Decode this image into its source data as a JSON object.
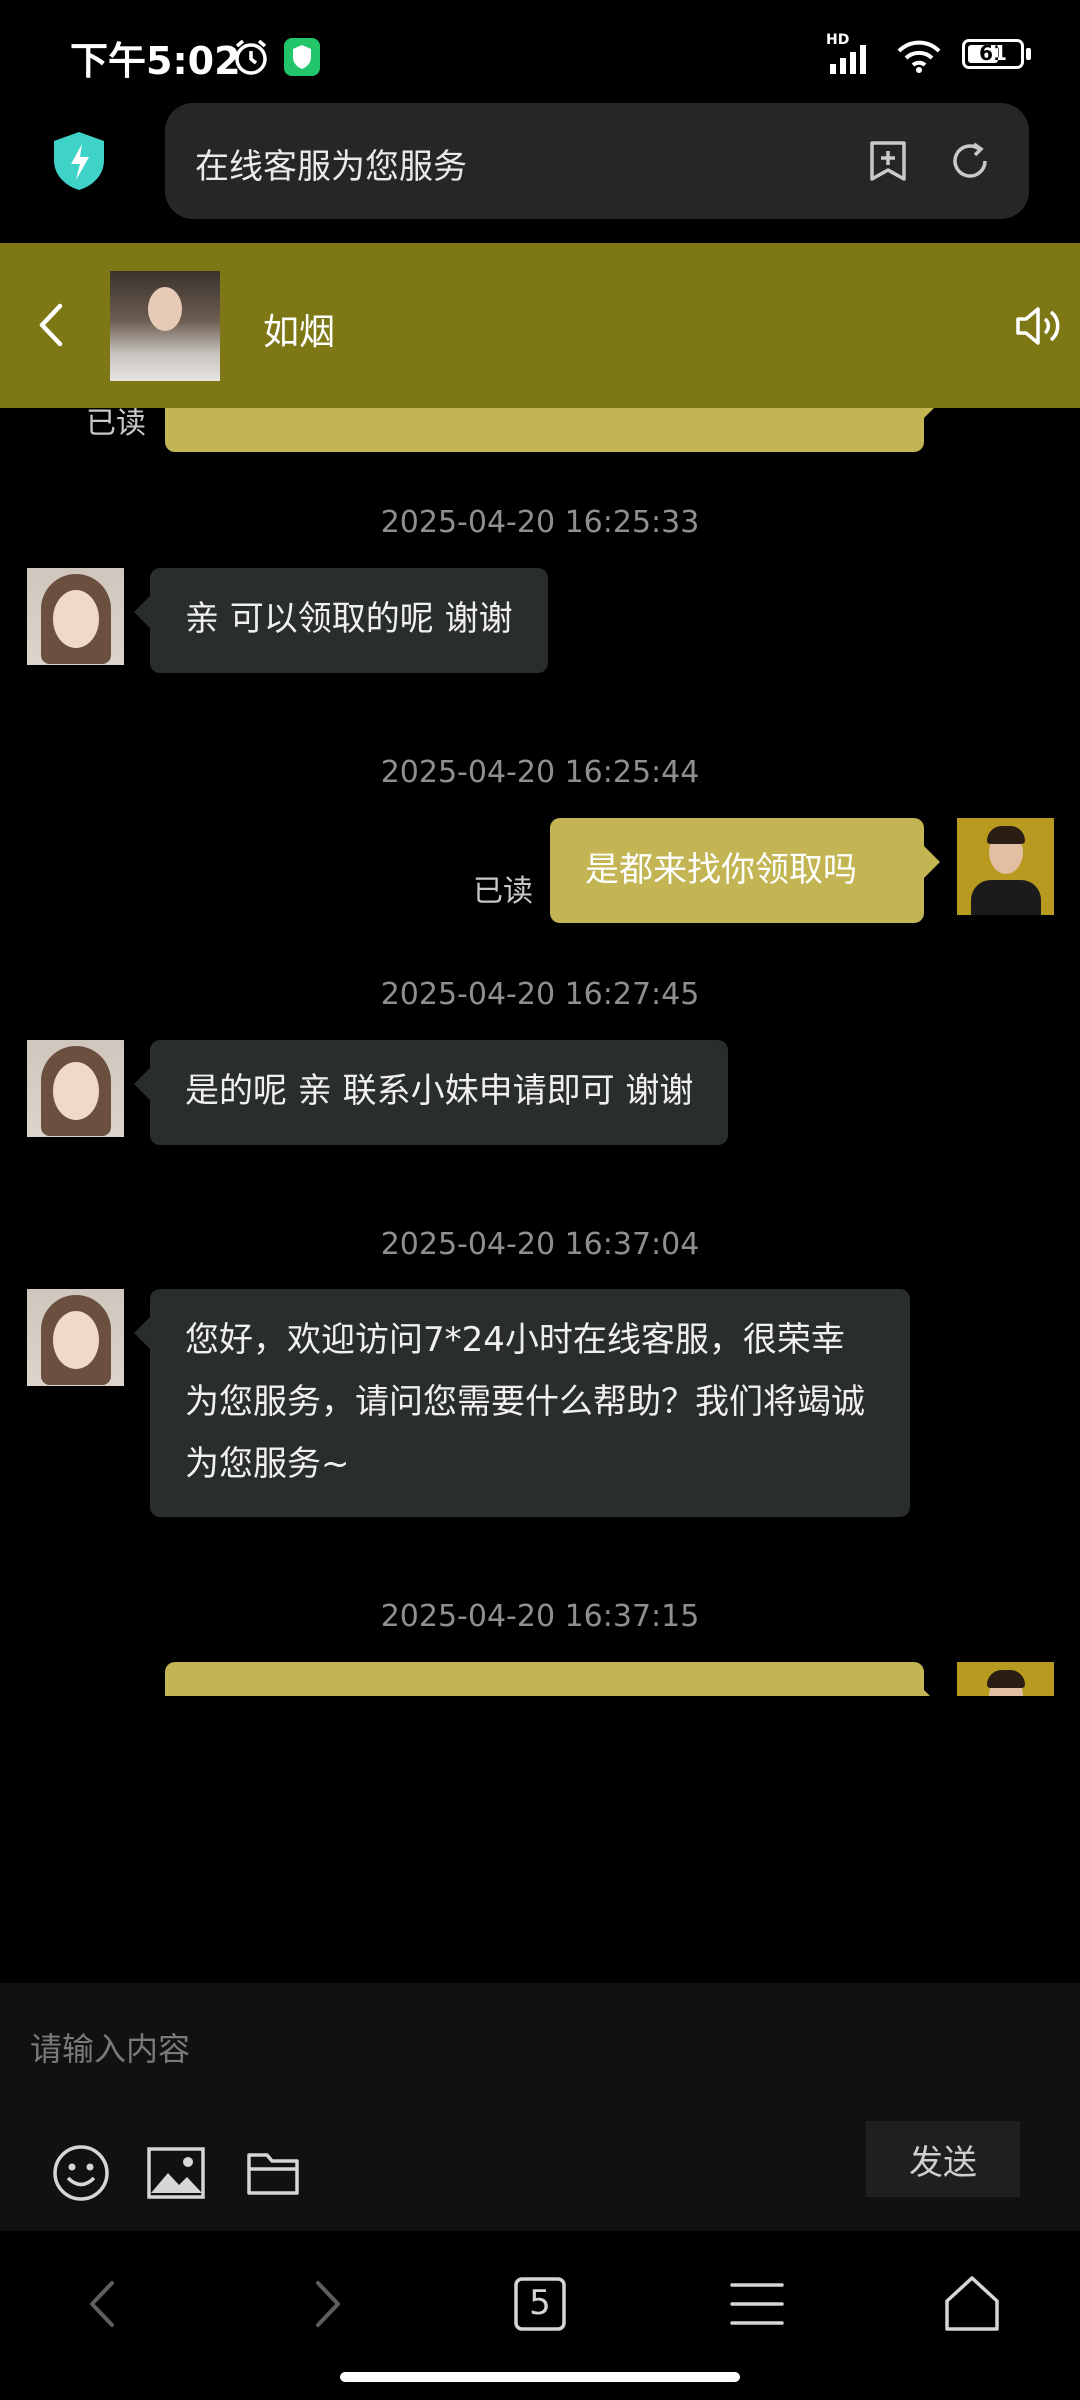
{
  "status_bar": {
    "time": "下午5:02",
    "network_label": "HD",
    "battery": "61"
  },
  "browser": {
    "address_text": "在线客服为您服务"
  },
  "chat_header": {
    "contact_name": "如烟"
  },
  "messages": [
    {
      "timestamp": "2025-04-20 16:25:33",
      "sender": "agent",
      "text": "亲 可以领取的呢 谢谢"
    },
    {
      "timestamp": "2025-04-20 16:25:44",
      "sender": "user",
      "text": "是都来找你领取吗",
      "status": "已读"
    },
    {
      "timestamp": "2025-04-20 16:27:45",
      "sender": "agent",
      "text": "是的呢 亲 联系小妹申请即可 谢谢"
    },
    {
      "timestamp": "2025-04-20 16:37:04",
      "sender": "agent",
      "text": "您好，欢迎访问7*24小时在线客服，很荣幸为您服务，请问您需要什么帮助？我们将竭诚为您服务~"
    },
    {
      "timestamp": "2025-04-20 16:37:15",
      "sender": "user",
      "text": ""
    }
  ],
  "partial_top": {
    "status": "已读"
  },
  "input": {
    "placeholder": "请输入内容",
    "send_label": "发送"
  },
  "browser_nav": {
    "tab_count": "5"
  },
  "colors": {
    "header_bg": "#7e7715",
    "user_bubble": "#c3b553",
    "agent_bubble": "#2a2d2d",
    "shield_accent": "#3fd3c7"
  }
}
